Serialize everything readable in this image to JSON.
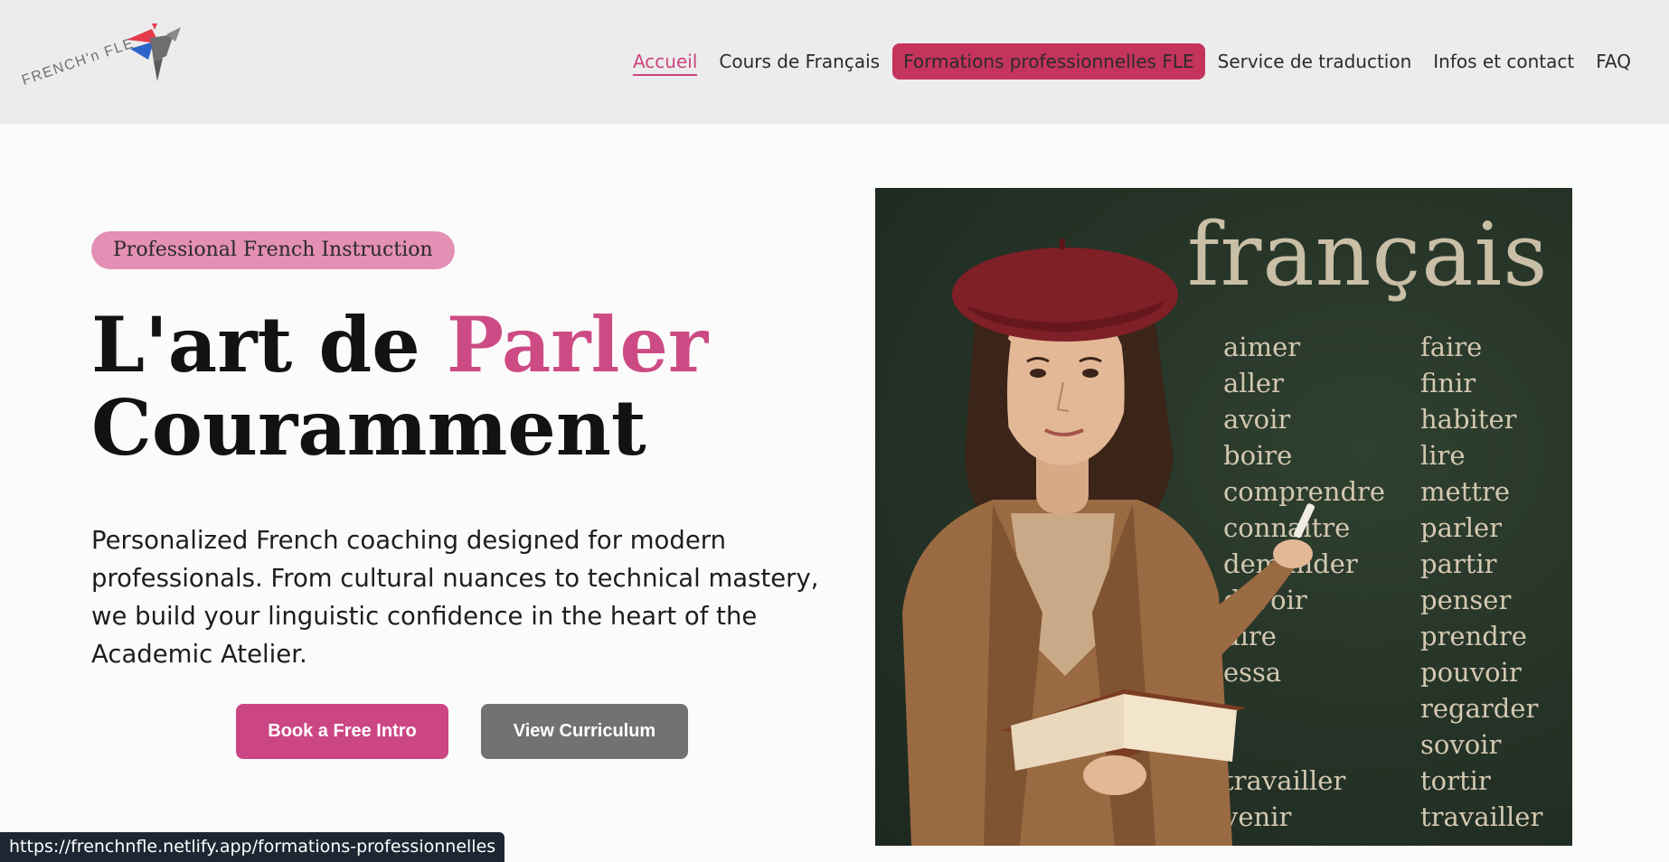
{
  "header": {
    "logo_text": "FRENCH'n FLE",
    "nav": [
      {
        "label": "Accueil",
        "state": "active"
      },
      {
        "label": "Cours de Français",
        "state": "normal"
      },
      {
        "label": "Formations professionnelles FLE",
        "state": "hover"
      },
      {
        "label": "Service de traduction",
        "state": "normal"
      },
      {
        "label": "Infos et contact",
        "state": "normal"
      },
      {
        "label": "FAQ",
        "state": "normal"
      }
    ]
  },
  "hero": {
    "tag": "Professional French Instruction",
    "title_part1": "L'art de ",
    "title_accent": "Parler",
    "title_part2": "Couramment",
    "description": "Personalized French coaching designed for modern professionals. From cultural nuances to technical mastery, we build your linguistic confidence in the heart of the Academic Atelier.",
    "primary_button": "Book a Free Intro",
    "secondary_button": "View Curriculum"
  },
  "hero_image": {
    "board_title": "français",
    "verbs_col1": [
      "aimer",
      "aller",
      "avoir",
      "boire",
      "comprendre",
      "connaitre",
      "demander",
      "devoir",
      "dire",
      "essa",
      "",
      "",
      "travailler",
      "venir"
    ],
    "verbs_col2": [
      "faire",
      "finir",
      "habiter",
      "lire",
      "mettre",
      "parler",
      "partir",
      "penser",
      "prendre",
      "pouvoir",
      "regarder",
      "sovoir",
      "tortir",
      "travailler"
    ]
  },
  "status_bar": {
    "url": "https://frenchnfle.netlify.app/formations-professionnelles"
  },
  "colors": {
    "accent_pink": "#cd4b84",
    "nav_highlight": "#c4345c",
    "tag_bg": "#e48fb4",
    "secondary_button": "#727272",
    "chalkboard": "#243126"
  },
  "icons": {
    "logo": "bird-logo-icon"
  }
}
